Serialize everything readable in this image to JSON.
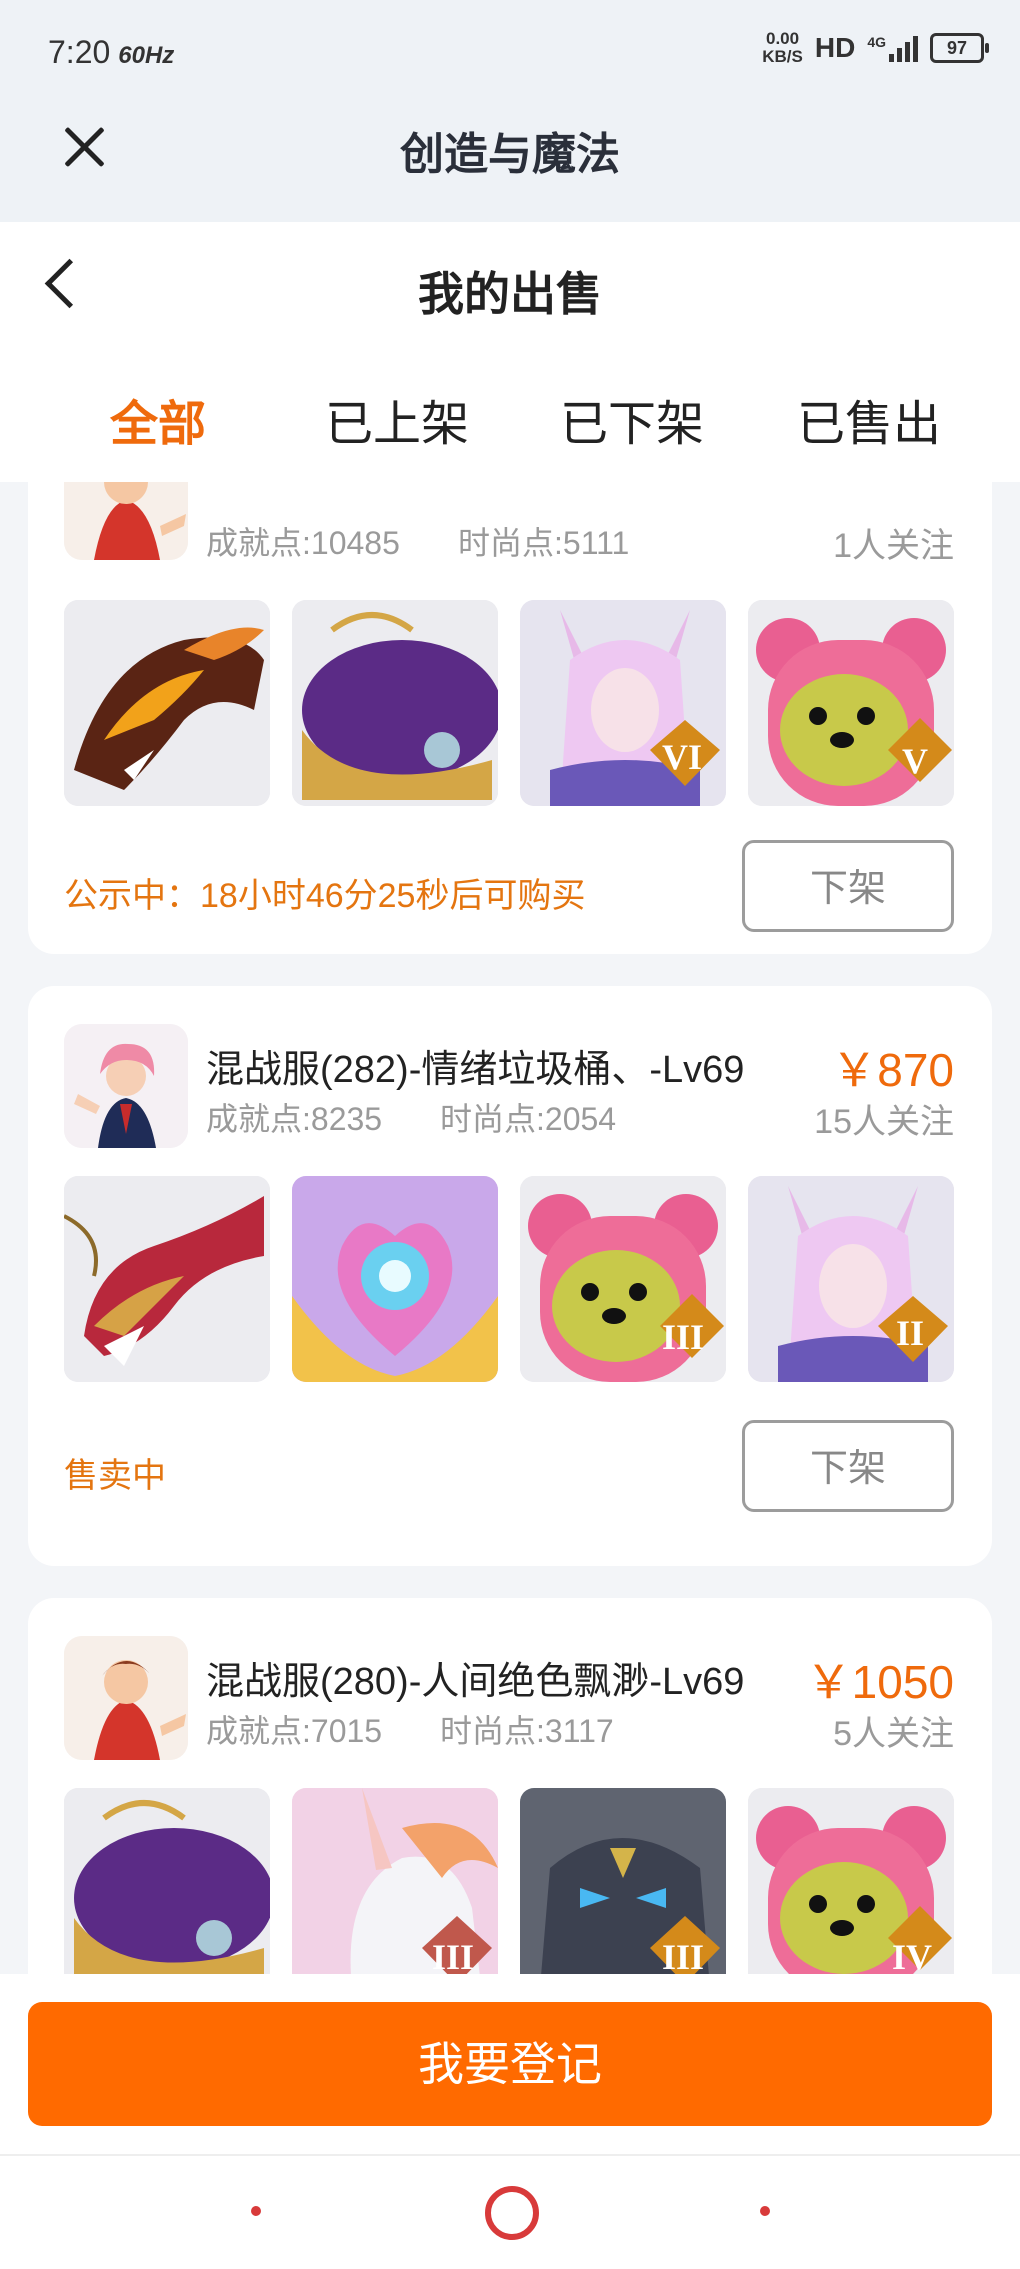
{
  "status_bar": {
    "time": "7:20",
    "refresh": "60Hz",
    "net_speed_value": "0.00",
    "net_speed_unit": "KB/S",
    "hd": "HD",
    "network": "4G",
    "battery": "97"
  },
  "app": {
    "title": "创造与魔法"
  },
  "page": {
    "title": "我的出售"
  },
  "tabs": [
    {
      "label": "全部",
      "active": true
    },
    {
      "label": "已上架",
      "active": false
    },
    {
      "label": "已下架",
      "active": false
    },
    {
      "label": "已售出",
      "active": false
    }
  ],
  "listings": [
    {
      "name": "",
      "achievement": "成就点:10485",
      "fashion": "时尚点:5111",
      "price": "",
      "followers": "1人关注",
      "items": [
        {
          "icon": "fire-dragon-mount"
        },
        {
          "icon": "golden-whale-mount"
        },
        {
          "icon": "fox-spirit-pet",
          "tier": "VI"
        },
        {
          "icon": "pink-bear-pet",
          "tier": "V"
        }
      ],
      "status": "公示中：18小时46分25秒后可购买",
      "action": "下架"
    },
    {
      "name": "混战服(282)-情绪垃圾桶、-Lv69",
      "achievement": "成就点:8235",
      "fashion": "时尚点:2054",
      "price": "￥870",
      "followers": "15人关注",
      "items": [
        {
          "icon": "red-dragon-mount"
        },
        {
          "icon": "heart-orb-wings"
        },
        {
          "icon": "pink-bear-pet",
          "tier": "III"
        },
        {
          "icon": "fox-spirit-pet",
          "tier": "II"
        }
      ],
      "status": "售卖中",
      "action": "下架"
    },
    {
      "name": "混战服(280)-人间绝色飘渺-Lv69",
      "achievement": "成就点:7015",
      "fashion": "时尚点:3117",
      "price": "￥1050",
      "followers": "5人关注",
      "items": [
        {
          "icon": "golden-whale-mount"
        },
        {
          "icon": "unicorn-mount",
          "tier": "III"
        },
        {
          "icon": "stone-golem-pet",
          "tier": "III"
        },
        {
          "icon": "pink-bear-pet",
          "tier": "IV"
        }
      ]
    }
  ],
  "register_button": "我要登记",
  "colors": {
    "accent": "#ff6a00",
    "status": "#e47510",
    "muted": "#9a9a9a"
  }
}
